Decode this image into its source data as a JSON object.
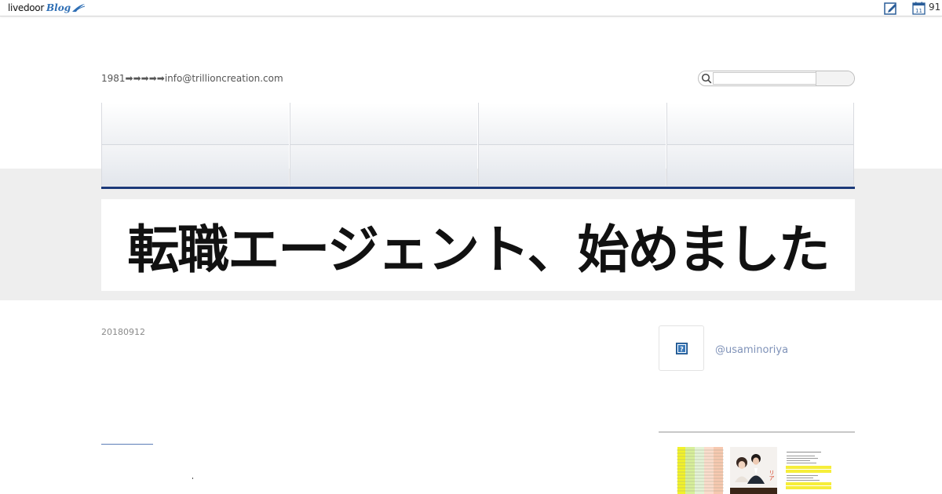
{
  "topbar": {
    "logo": {
      "word1": "livedoor",
      "word2": "Blog"
    },
    "edit_icon": "edit-icon",
    "calendar_icon": {
      "icon": "calendar-icon",
      "day": "11"
    },
    "count": "91"
  },
  "header": {
    "description": "1981➡➡➡➡➡info@trillioncreation.com",
    "search": {
      "icon": "search-icon",
      "placeholder": "",
      "button_label": ""
    }
  },
  "nav": {
    "row1": [
      "",
      "",
      "",
      ""
    ],
    "row2": [
      "",
      "",
      "",
      ""
    ],
    "accent_color": "#1b3a7a"
  },
  "banner": {
    "title": "転職エージェント、始めました"
  },
  "article": {
    "date": "20180912"
  },
  "sidebar": {
    "profile": {
      "avatar_icon": "question-mark-icon",
      "handle": "@usaminoriya"
    },
    "thumbnails": [
      "spreadsheet-thumbnail",
      "couple-photo-thumbnail",
      "flyer-thumbnail"
    ]
  },
  "colors": {
    "band": "#eeeeee",
    "link": "#7f92b8",
    "brand": "#2f6fb5"
  }
}
